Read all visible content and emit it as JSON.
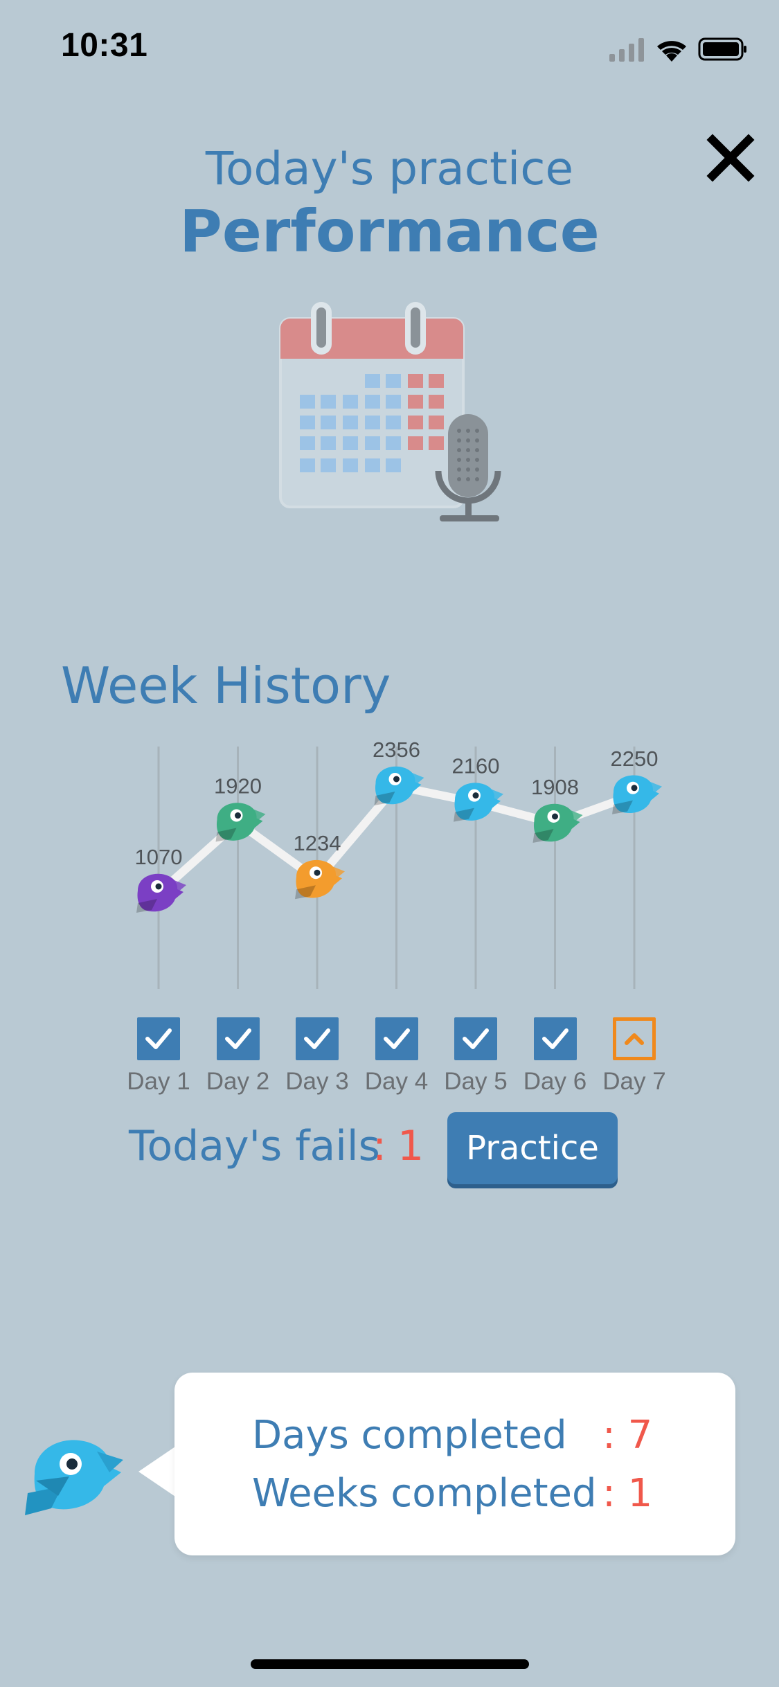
{
  "status_bar": {
    "time": "10:31",
    "signal_icon": "signal-bars-icon",
    "wifi_icon": "wifi-icon",
    "battery_icon": "battery-icon"
  },
  "header": {
    "subtitle": "Today's practice",
    "title": "Performance",
    "close_icon": "close-icon",
    "hero_icon": "calendar-microphone-icon"
  },
  "week_history": {
    "title": "Week History"
  },
  "chart_data": {
    "type": "line",
    "categories": [
      "Day 1",
      "Day 2",
      "Day 3",
      "Day 4",
      "Day 5",
      "Day 6",
      "Day 7"
    ],
    "values": [
      1070,
      1920,
      1234,
      2356,
      2160,
      1908,
      2250
    ],
    "marker_colors": [
      "#7b3fc4",
      "#3fae84",
      "#f39c2d",
      "#35b8e8",
      "#35b8e8",
      "#3fae84",
      "#35b8e8"
    ],
    "line_color": "#f2f2f2",
    "grid_color": "#a7b3ba",
    "completed": [
      true,
      true,
      true,
      true,
      true,
      true,
      false
    ]
  },
  "fails": {
    "label": "Today's fails",
    "colon": ":",
    "value": "1"
  },
  "practice_button": {
    "label": "Practice"
  },
  "summary": {
    "days_label": "Days completed",
    "days_value": ": 7",
    "weeks_label": "Weeks completed",
    "weeks_value": ": 1"
  },
  "colors": {
    "background": "#b9c9d3",
    "accent": "#3e7db3",
    "highlight": "#f0584b",
    "pending": "#f0891c"
  }
}
